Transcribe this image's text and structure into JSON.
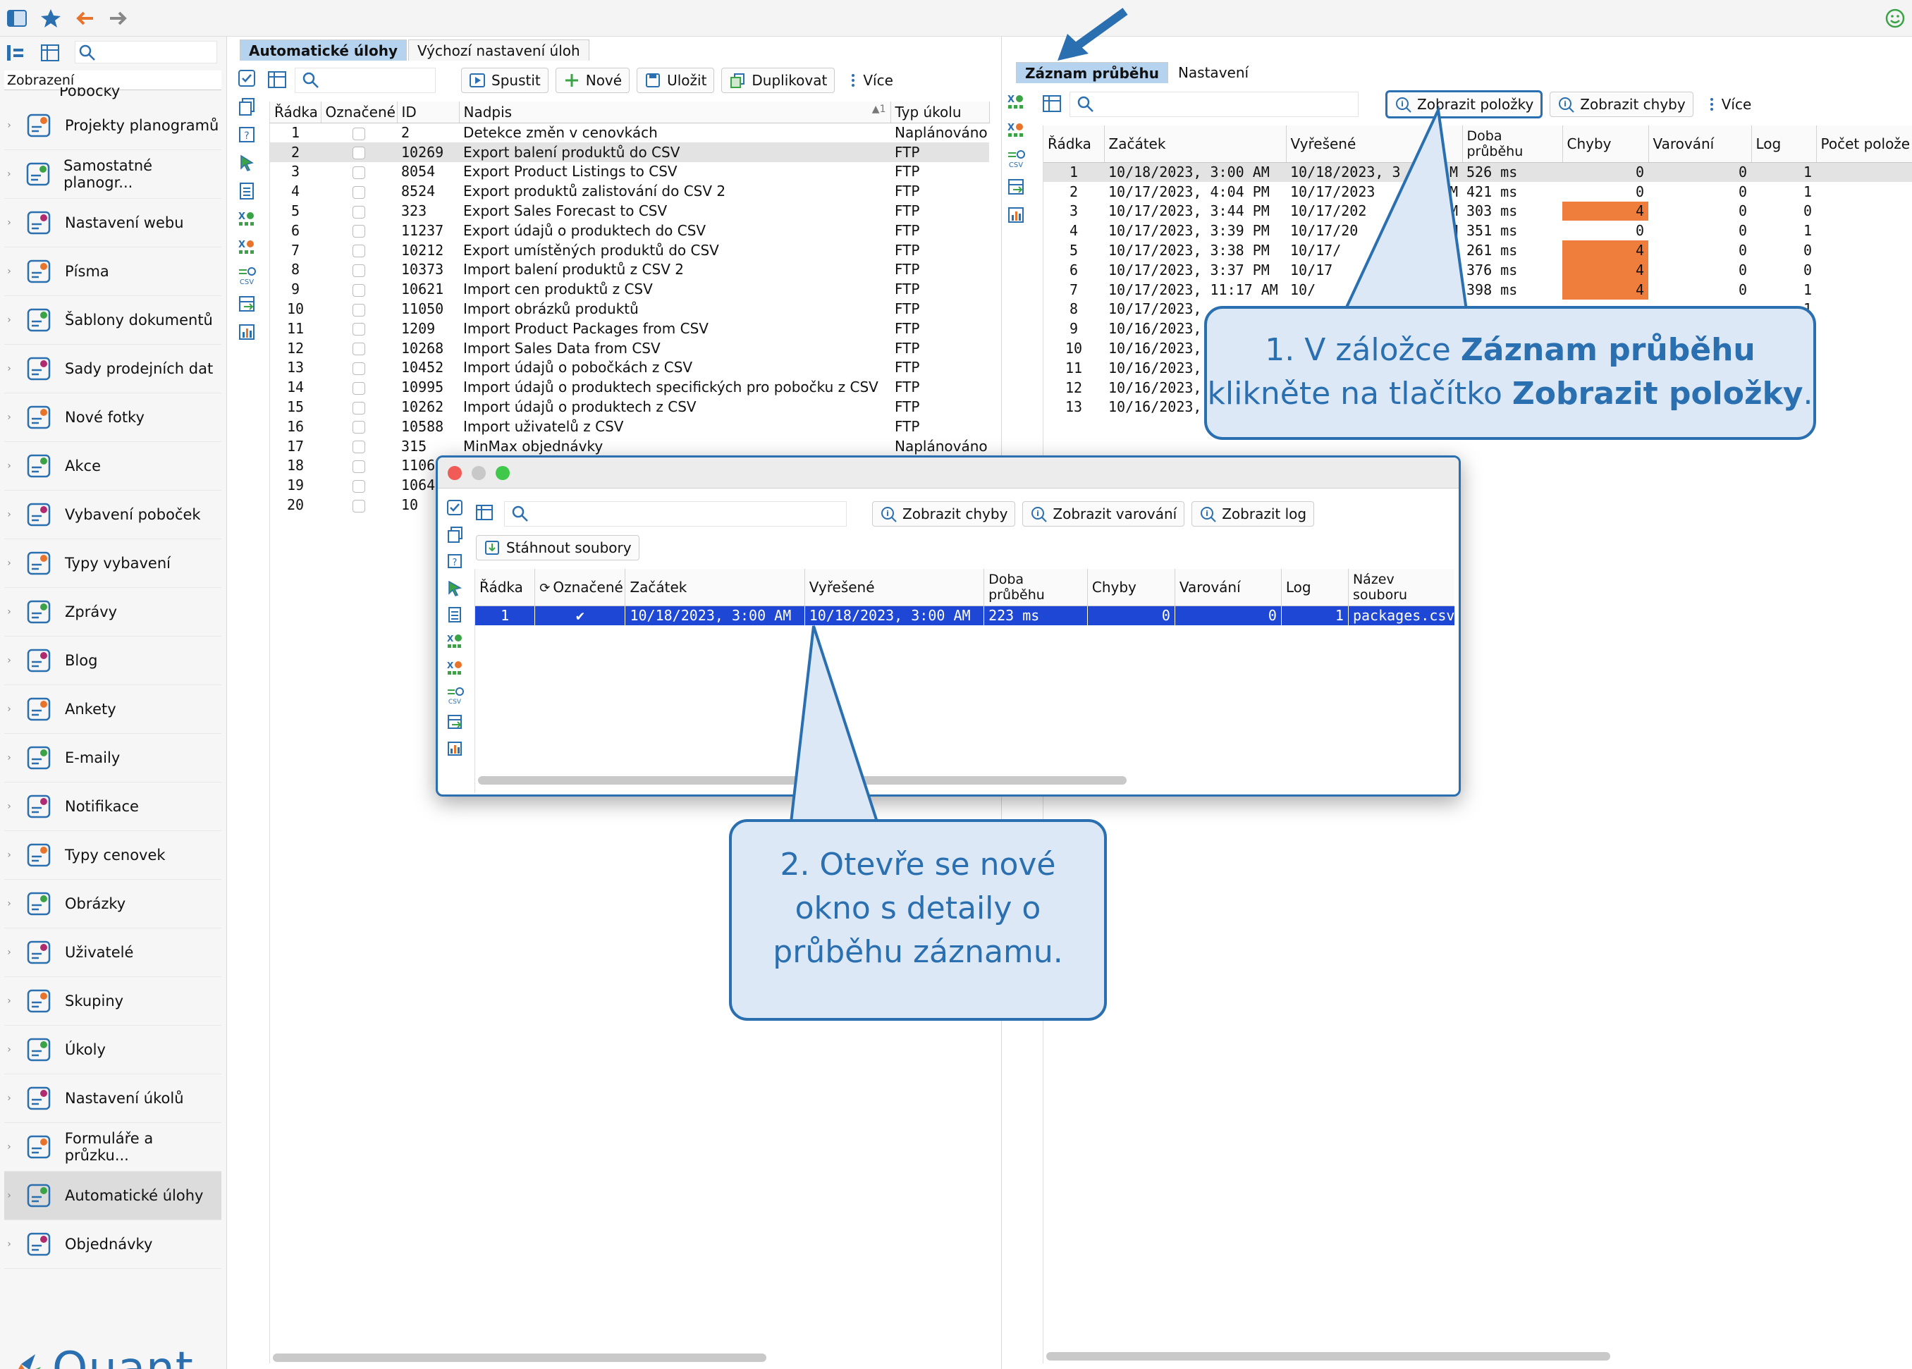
{
  "colors": {
    "accent": "#2a6fb0",
    "error_cell": "#ef7d3c",
    "selection_blue": "#1e47d6",
    "tab_active": "#b5d3ef"
  },
  "sidebar": {
    "header": "Zobrazení",
    "partial_item": "Pobočky",
    "items": [
      {
        "label": "Projekty planogramů",
        "icon": "planogram-icon"
      },
      {
        "label": "Samostatné planogr...",
        "icon": "planogram-grid-icon"
      },
      {
        "label": "Nastavení webu",
        "icon": "globe-icon"
      },
      {
        "label": "Písma",
        "icon": "font-icon"
      },
      {
        "label": "Šablony dokumentů",
        "icon": "document-template-icon"
      },
      {
        "label": "Sady prodejních dat",
        "icon": "sales-data-icon"
      },
      {
        "label": "Nové fotky",
        "icon": "camera-icon"
      },
      {
        "label": "Akce",
        "icon": "clock-icon"
      },
      {
        "label": "Vybavení poboček",
        "icon": "equipment-icon"
      },
      {
        "label": "Typy vybavení",
        "icon": "equipment-types-icon"
      },
      {
        "label": "Zprávy",
        "icon": "message-icon"
      },
      {
        "label": "Blog",
        "icon": "blog-icon"
      },
      {
        "label": "Ankety",
        "icon": "survey-icon"
      },
      {
        "label": "E-maily",
        "icon": "email-icon"
      },
      {
        "label": "Notifikace",
        "icon": "bell-icon"
      },
      {
        "label": "Typy cenovek",
        "icon": "price-tag-icon"
      },
      {
        "label": "Obrázky",
        "icon": "image-icon"
      },
      {
        "label": "Uživatelé",
        "icon": "user-icon"
      },
      {
        "label": "Skupiny",
        "icon": "group-icon"
      },
      {
        "label": "Úkoly",
        "icon": "task-check-icon"
      },
      {
        "label": "Nastavení úkolů",
        "icon": "task-settings-icon"
      },
      {
        "label": "Formuláře a průzku...",
        "icon": "form-icon"
      },
      {
        "label": "Automatické úlohy",
        "icon": "automatic-tasks-icon"
      },
      {
        "label": "Objednávky",
        "icon": "orders-icon"
      }
    ],
    "logo_text": "Quant"
  },
  "middle": {
    "tabs": [
      "Automatické úlohy",
      "Výchozí nastavení úloh"
    ],
    "toolbar": {
      "run": "Spustit",
      "new": "Nové",
      "save": "Uložit",
      "duplicate": "Duplikovat",
      "more": "Více"
    },
    "columns": [
      "Řádka",
      "Označené",
      "ID",
      "Nadpis",
      "Typ úkolu"
    ],
    "sort_indicator": "1",
    "rows": [
      [
        "1",
        "2",
        "Detekce změn v cenovkách",
        "Naplánováno"
      ],
      [
        "2",
        "10269",
        "Export balení produktů do CSV",
        "FTP"
      ],
      [
        "3",
        "8054",
        "Export Product Listings to CSV",
        "FTP"
      ],
      [
        "4",
        "8524",
        "Export produktů zalistování do CSV 2",
        "FTP"
      ],
      [
        "5",
        "323",
        "Export Sales Forecast to CSV",
        "FTP"
      ],
      [
        "6",
        "11237",
        "Export údajů o produktech do CSV",
        "FTP"
      ],
      [
        "7",
        "10212",
        "Export umístěných produktů do CSV",
        "FTP"
      ],
      [
        "8",
        "10373",
        "Import balení produktů z CSV 2",
        "FTP"
      ],
      [
        "9",
        "10621",
        "Import cen produktů z CSV",
        "FTP"
      ],
      [
        "10",
        "11050",
        "Import obrázků produktů",
        "FTP"
      ],
      [
        "11",
        "1209",
        "Import Product Packages from CSV",
        "FTP"
      ],
      [
        "12",
        "10268",
        "Import Sales Data from CSV",
        "FTP"
      ],
      [
        "13",
        "10452",
        "Import údajů o pobočkách z CSV",
        "FTP"
      ],
      [
        "14",
        "10995",
        "Import údajů o produktech specifických pro pobočku z CSV",
        "FTP"
      ],
      [
        "15",
        "10262",
        "Import údajů o produktech z CSV",
        "FTP"
      ],
      [
        "16",
        "10588",
        "Import uživatelů z CSV",
        "FTP"
      ],
      [
        "17",
        "315",
        "MinMax objednávky",
        "Naplánováno"
      ],
      [
        "18",
        "1106",
        "",
        ""
      ],
      [
        "19",
        "1064",
        "",
        ""
      ],
      [
        "20",
        "10",
        "",
        ""
      ]
    ]
  },
  "right": {
    "tabs": [
      "Záznam průběhu",
      "Nastavení"
    ],
    "toolbar": {
      "show_items": "Zobrazit položky",
      "show_errors": "Zobrazit chyby",
      "more": "Více"
    },
    "columns": [
      "Řádka",
      "Začátek",
      "Vyřešené",
      "Doba průběhu",
      "Chyby",
      "Varování",
      "Log",
      "Počet polože"
    ],
    "rows": [
      [
        "1",
        "10/18/2023, 3:00 AM",
        "10/18/2023, 3",
        "M",
        "526 ms",
        "0",
        "0",
        "1"
      ],
      [
        "2",
        "10/17/2023, 4:04 PM",
        "10/17/2023",
        "M",
        "421 ms",
        "0",
        "0",
        "1"
      ],
      [
        "3",
        "10/17/2023, 3:44 PM",
        "10/17/202",
        "M",
        "303 ms",
        "4",
        "0",
        "0"
      ],
      [
        "4",
        "10/17/2023, 3:39 PM",
        "10/17/20",
        "M",
        "351 ms",
        "0",
        "0",
        "1"
      ],
      [
        "5",
        "10/17/2023, 3:38 PM",
        "10/17/",
        "",
        "261 ms",
        "4",
        "0",
        "0"
      ],
      [
        "6",
        "10/17/2023, 3:37 PM",
        "10/17",
        "",
        "376 ms",
        "4",
        "0",
        "0"
      ],
      [
        "7",
        "10/17/2023, 11:17 AM",
        "10/",
        "",
        "398 ms",
        "4",
        "0",
        "1"
      ],
      [
        "8",
        "10/17/2023,",
        "",
        "",
        "",
        "",
        "",
        "1"
      ],
      [
        "9",
        "10/16/2023,",
        "",
        "",
        "",
        "",
        "",
        ""
      ],
      [
        "10",
        "10/16/2023,",
        "",
        "",
        "",
        "",
        "",
        ""
      ],
      [
        "11",
        "10/16/2023,",
        "",
        "",
        "",
        "",
        "",
        ""
      ],
      [
        "12",
        "10/16/2023,",
        "",
        "",
        "",
        "",
        "",
        ""
      ],
      [
        "13",
        "10/16/2023,",
        "",
        "",
        "",
        "",
        "",
        ""
      ]
    ]
  },
  "popup": {
    "toolbar": {
      "show_errors": "Zobrazit chyby",
      "show_warnings": "Zobrazit varování",
      "show_log": "Zobrazit log",
      "download": "Stáhnout soubory"
    },
    "columns": [
      "Řádka",
      "Označené",
      "Začátek",
      "Vyřešené",
      "Doba průběhu",
      "Chyby",
      "Varování",
      "Log",
      "Název souboru"
    ],
    "row": [
      "1",
      "10/18/2023, 3:00 AM",
      "10/18/2023, 3:00 AM",
      "223 ms",
      "0",
      "0",
      "1",
      "packages.csv"
    ]
  },
  "callouts": {
    "one": {
      "pre": "1. V záložce ",
      "b1": "Záznam průběhu",
      "mid": "klikněte na tlačítko ",
      "b2": "Zobrazit položky",
      "post": "."
    },
    "two": {
      "l1": "2. Otevře se nové",
      "l2": "okno s detaily o",
      "l3": "průběhu záznamu."
    }
  }
}
